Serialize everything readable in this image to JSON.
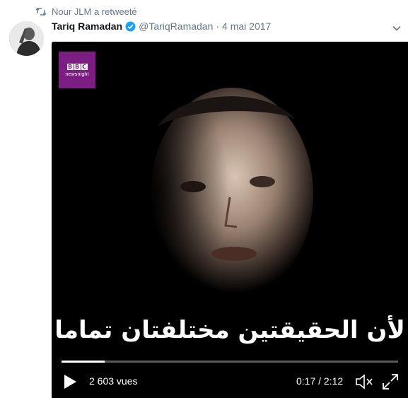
{
  "retweet": {
    "icon": "retweet-icon",
    "text": "Nour JLM a retweeté"
  },
  "tweet": {
    "author_name": "Tariq Ramadan",
    "verified": true,
    "handle": "@TariqRamadan",
    "separator": "·",
    "date": "4 mai 2017"
  },
  "video": {
    "logo": {
      "brand_letters": [
        "B",
        "B",
        "C"
      ],
      "program": "newsnight"
    },
    "subtitle": "لأن الحقيقتين مختلفتان تماما",
    "views": "2 603 vues",
    "timecode": "0:17 / 2:12",
    "progress": 0.128
  },
  "colors": {
    "muted": "#657786",
    "verified": "#1da1f2",
    "bbc_purple": "#7b1d82"
  }
}
